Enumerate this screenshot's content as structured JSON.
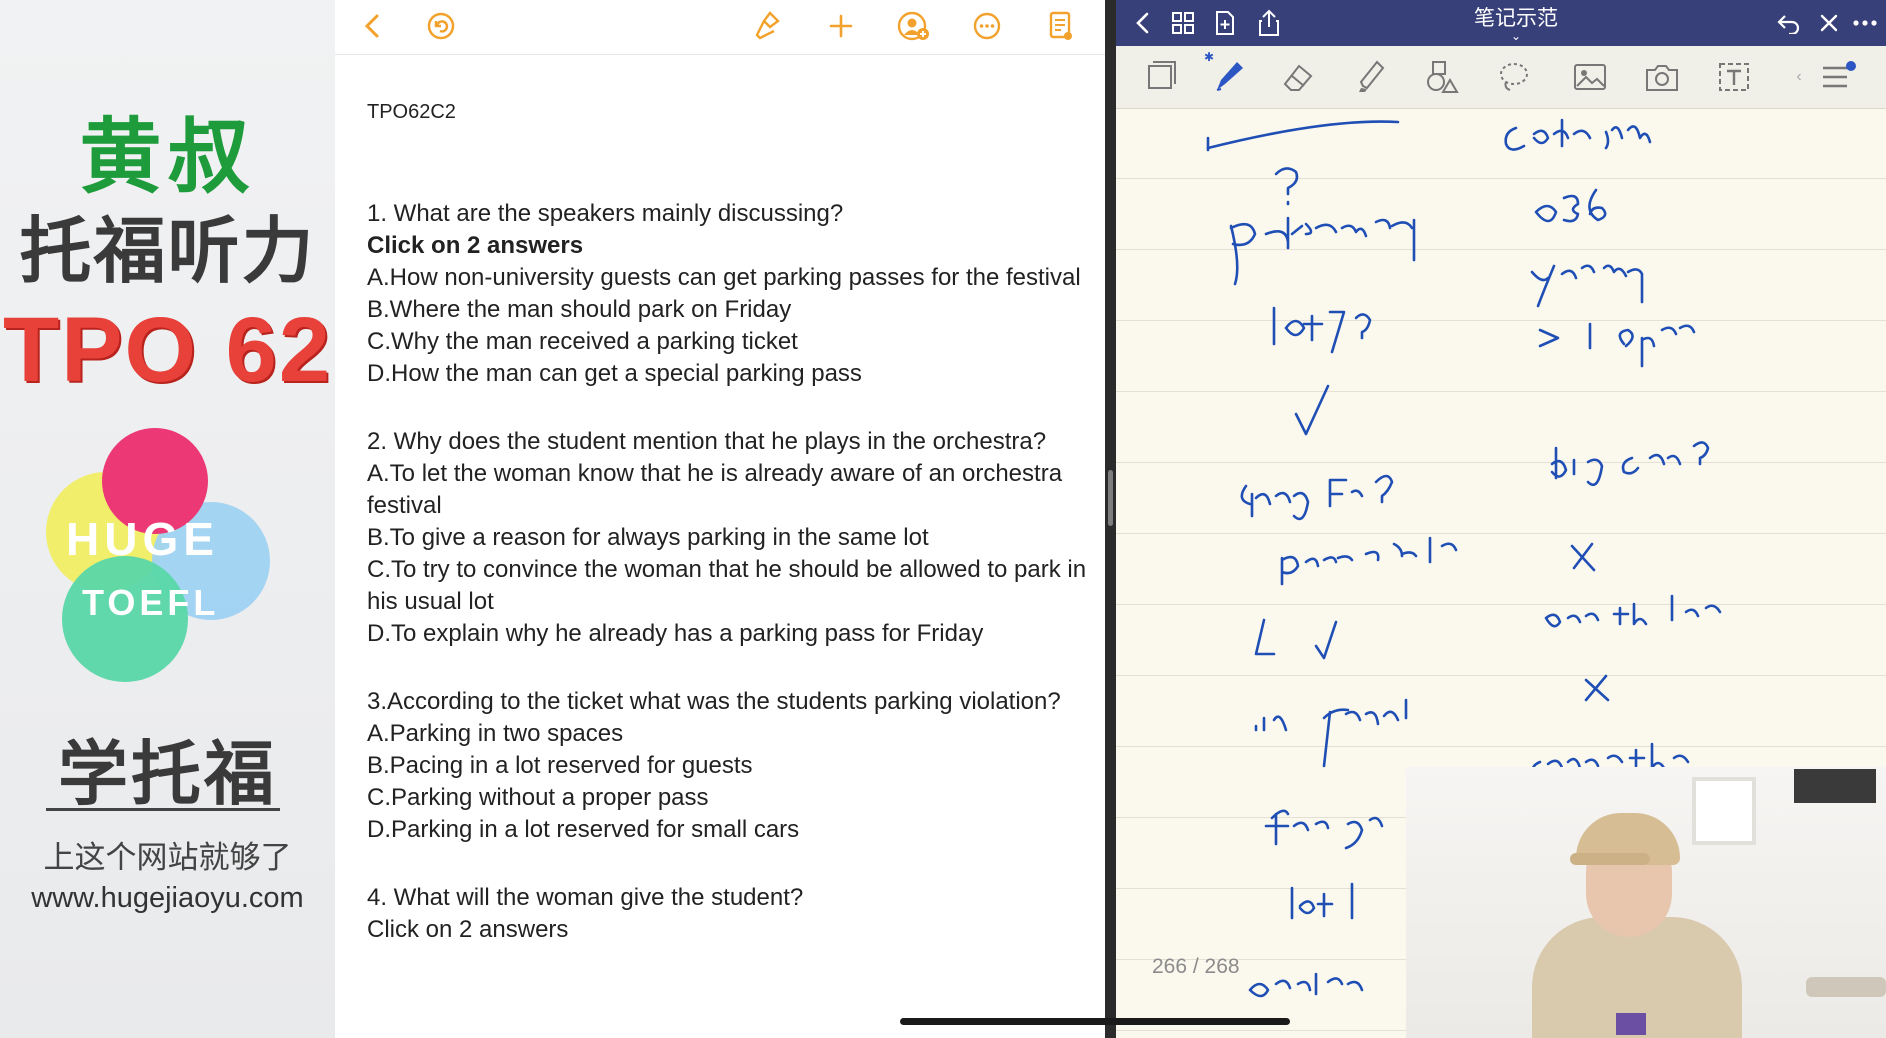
{
  "promo": {
    "brand_cn": "黄叔",
    "subtitle": "托福听力",
    "tpo": "TPO 62",
    "logo_line1": "HUGE",
    "logo_line2": "TOEFL",
    "learn": "学托福",
    "slogan": "上这个网站就够了",
    "website": "www.hugejiaoyu.com"
  },
  "doc": {
    "toolbar_icons": [
      "chevron-left-icon",
      "undo-icon",
      "brush-icon",
      "plus-icon",
      "add-person-icon",
      "more-icon",
      "reader-icon"
    ],
    "title": "TPO62C2",
    "questions": [
      {
        "stem": "1. What are the speakers mainly discussing?",
        "instruction": "Click on 2 answers",
        "options": [
          "A.How non-university guests can get parking passes for the festival",
          "B.Where the man should park on Friday",
          "C.Why the man received a parking ticket",
          "D.How the man can get a special parking pass"
        ]
      },
      {
        "stem": "2. Why does the student mention that he plays in the orchestra?",
        "options": [
          "A.To let the woman know that he is already aware of an orchestra festival",
          "B.To give a reason for always parking in the same lot",
          "C.To try to convince the woman that he should be allowed to park in his usual lot",
          "D.To explain why he already has a parking pass for Friday"
        ]
      },
      {
        "stem": "3.According to the ticket what was the students parking violation?",
        "options": [
          "A.Parking in two spaces",
          "B.Pacing in a lot reserved for guests",
          "C.Parking without a proper pass",
          "D.Parking in a lot reserved for small cars"
        ]
      },
      {
        "stem": "4. What will the woman give the student?",
        "instruction": "Click on 2 answers"
      }
    ]
  },
  "notes": {
    "title": "笔记示范",
    "title_caret": "⌄",
    "pager": "266 / 268",
    "colors": {
      "bar": "#38407a",
      "ink": "#1f4fb5",
      "paper": "#fbf8ee"
    }
  }
}
